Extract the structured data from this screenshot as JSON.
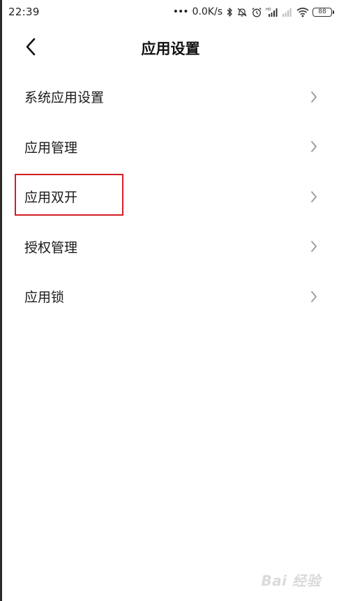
{
  "status_bar": {
    "time": "22:39",
    "dots": "•••",
    "net_speed": "0.0K/s",
    "battery_level": "88",
    "icons": [
      "bluetooth-icon",
      "mute-icon",
      "alarm-icon",
      "hd-signal-icon",
      "signal-icon",
      "wifi-icon",
      "battery-icon"
    ]
  },
  "header": {
    "title": "应用设置",
    "back_icon": "chevron-left-icon"
  },
  "menu": {
    "items": [
      {
        "label": "系统应用设置"
      },
      {
        "label": "应用管理"
      },
      {
        "label": "应用双开"
      },
      {
        "label": "授权管理"
      },
      {
        "label": "应用锁"
      }
    ],
    "chevron_icon": "chevron-right-icon"
  },
  "annotation": {
    "highlight_color": "#d21e24",
    "highlighted_item": "应用双开"
  },
  "watermark": {
    "text": "Bai 经验"
  },
  "colors": {
    "background": "#ffffff",
    "text": "#1a1a1a",
    "chevron": "#9a9a9a"
  }
}
